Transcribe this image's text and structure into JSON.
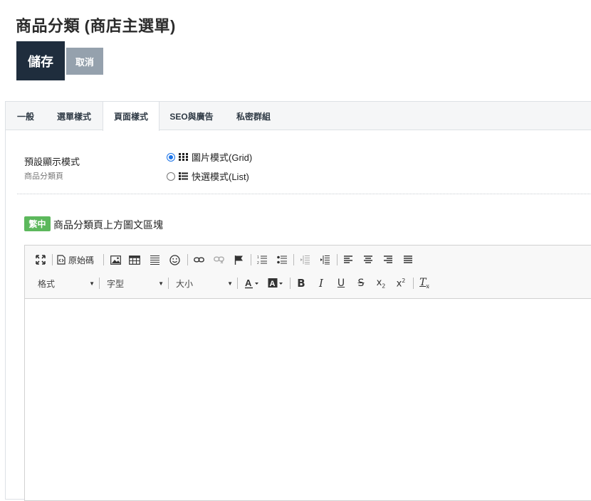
{
  "header": {
    "title": "商品分類 (商店主選單)",
    "save_label": "儲存",
    "cancel_label": "取消"
  },
  "tabs": [
    {
      "label": "一般",
      "active": false
    },
    {
      "label": "選單樣式",
      "active": false
    },
    {
      "label": "頁面樣式",
      "active": true
    },
    {
      "label": "SEO與廣告",
      "active": false
    },
    {
      "label": "私密群組",
      "active": false
    }
  ],
  "display_mode": {
    "label": "預設顯示模式",
    "sublabel": "商品分類頁",
    "options": [
      {
        "label": "圖片模式(Grid)",
        "icon": "grid-icon",
        "checked": true
      },
      {
        "label": "快選模式(List)",
        "icon": "list-icon",
        "checked": false
      }
    ]
  },
  "content_block": {
    "lang_badge": "繁中",
    "label": "商品分類頁上方圖文區塊",
    "badge_color": "#5cb85c"
  },
  "editor": {
    "source_label": "原始碼",
    "format_label": "格式",
    "font_label": "字型",
    "size_label": "大小",
    "body_text": ""
  },
  "colors": {
    "save_bg": "#1f2d3d",
    "cancel_bg": "#95a1ad",
    "radio_accent": "#1a73e8"
  }
}
